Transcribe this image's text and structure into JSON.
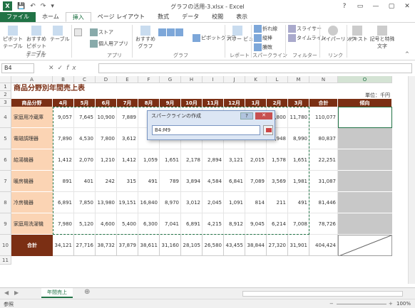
{
  "window": {
    "title": "グラフの活用-3.xlsx - Excel",
    "controls": [
      "?",
      "▭",
      "—",
      "▢",
      "✕"
    ]
  },
  "tabs": [
    "ファイル",
    "ホーム",
    "挿入",
    "ページ レイアウト",
    "数式",
    "データ",
    "校閲",
    "表示"
  ],
  "ribbon": {
    "groups": [
      "テーブル",
      "アプリ",
      "グラフ",
      "レポート",
      "スパークライン",
      "フィルター",
      "リンク"
    ],
    "pivot": "ピボット テーブル",
    "recommended_pivot": "おすすめ ピボットテーブル",
    "table": "テーブル",
    "store": "ストア",
    "my_apps": "個人用アプリ",
    "recommended_charts": "おすすめ グラフ",
    "pivot_chart": "ピボットグラフ",
    "power_view": "パワー ビュー",
    "line": "折れ線",
    "column": "縦棒",
    "win_loss": "勝敗",
    "slicer": "スライサー",
    "timeline": "タイムライン",
    "hyperlink": "ハイパーリンク",
    "text": "テキスト",
    "equation": "記号と特殊文字"
  },
  "formula_bar": {
    "name_box": "B4",
    "formula": ""
  },
  "sheet": {
    "col_headers": [
      "",
      "A",
      "B",
      "C",
      "D",
      "E",
      "F",
      "G",
      "H",
      "I",
      "J",
      "K",
      "L",
      "M",
      "N",
      "O"
    ],
    "row_headers": [
      "1",
      "2",
      "3",
      "4",
      "5",
      "6",
      "7",
      "8",
      "9",
      "10",
      "11"
    ],
    "title": "商品分野別年間売上表",
    "unit": "単位：千円",
    "header_row": [
      "商品分野",
      "4月",
      "5月",
      "6月",
      "7月",
      "8月",
      "9月",
      "10月",
      "11月",
      "12月",
      "1月",
      "2月",
      "3月",
      "合計",
      "傾向"
    ],
    "rows": [
      [
        "家庭用冷蔵庫",
        "9,057",
        "7,645",
        "10,900",
        "7,889",
        "",
        "",
        "",
        "",
        "",
        "",
        "7,800",
        "11,780",
        "110,077"
      ],
      [
        "電磁調理器",
        "7,890",
        "4,530",
        "7,800",
        "3,612",
        "",
        "",
        "",
        "",
        "",
        "",
        "4,948",
        "8,990",
        "80,837"
      ],
      [
        "給湯機器",
        "1,412",
        "2,070",
        "1,210",
        "1,412",
        "1,059",
        "1,651",
        "2,178",
        "2,894",
        "3,121",
        "2,015",
        "1,578",
        "1,651",
        "22,251"
      ],
      [
        "暖房機器",
        "891",
        "401",
        "242",
        "315",
        "491",
        "789",
        "3,894",
        "4,584",
        "6,841",
        "7,089",
        "3,569",
        "1,981",
        "31,087"
      ],
      [
        "冷房機器",
        "6,891",
        "7,850",
        "13,980",
        "19,151",
        "16,840",
        "8,970",
        "3,012",
        "2,045",
        "1,091",
        "814",
        "211",
        "491",
        "81,446"
      ],
      [
        "家庭用洗濯機",
        "7,980",
        "5,120",
        "4,600",
        "5,400",
        "6,300",
        "7,041",
        "6,891",
        "4,215",
        "8,912",
        "9,045",
        "6,214",
        "7,008",
        "78,726"
      ]
    ],
    "total_label": "合計",
    "totals": [
      "34,121",
      "27,716",
      "38,732",
      "37,879",
      "38,611",
      "31,160",
      "28,105",
      "26,580",
      "43,455",
      "38,844",
      "27,320",
      "31,901",
      "404,424"
    ]
  },
  "dialog": {
    "title": "スパークラインの作成",
    "range": "B4:M9",
    "help": "?",
    "close": "✕"
  },
  "sheet_tab": "年間売上",
  "status": {
    "mode": "参照",
    "zoom": "100%"
  }
}
